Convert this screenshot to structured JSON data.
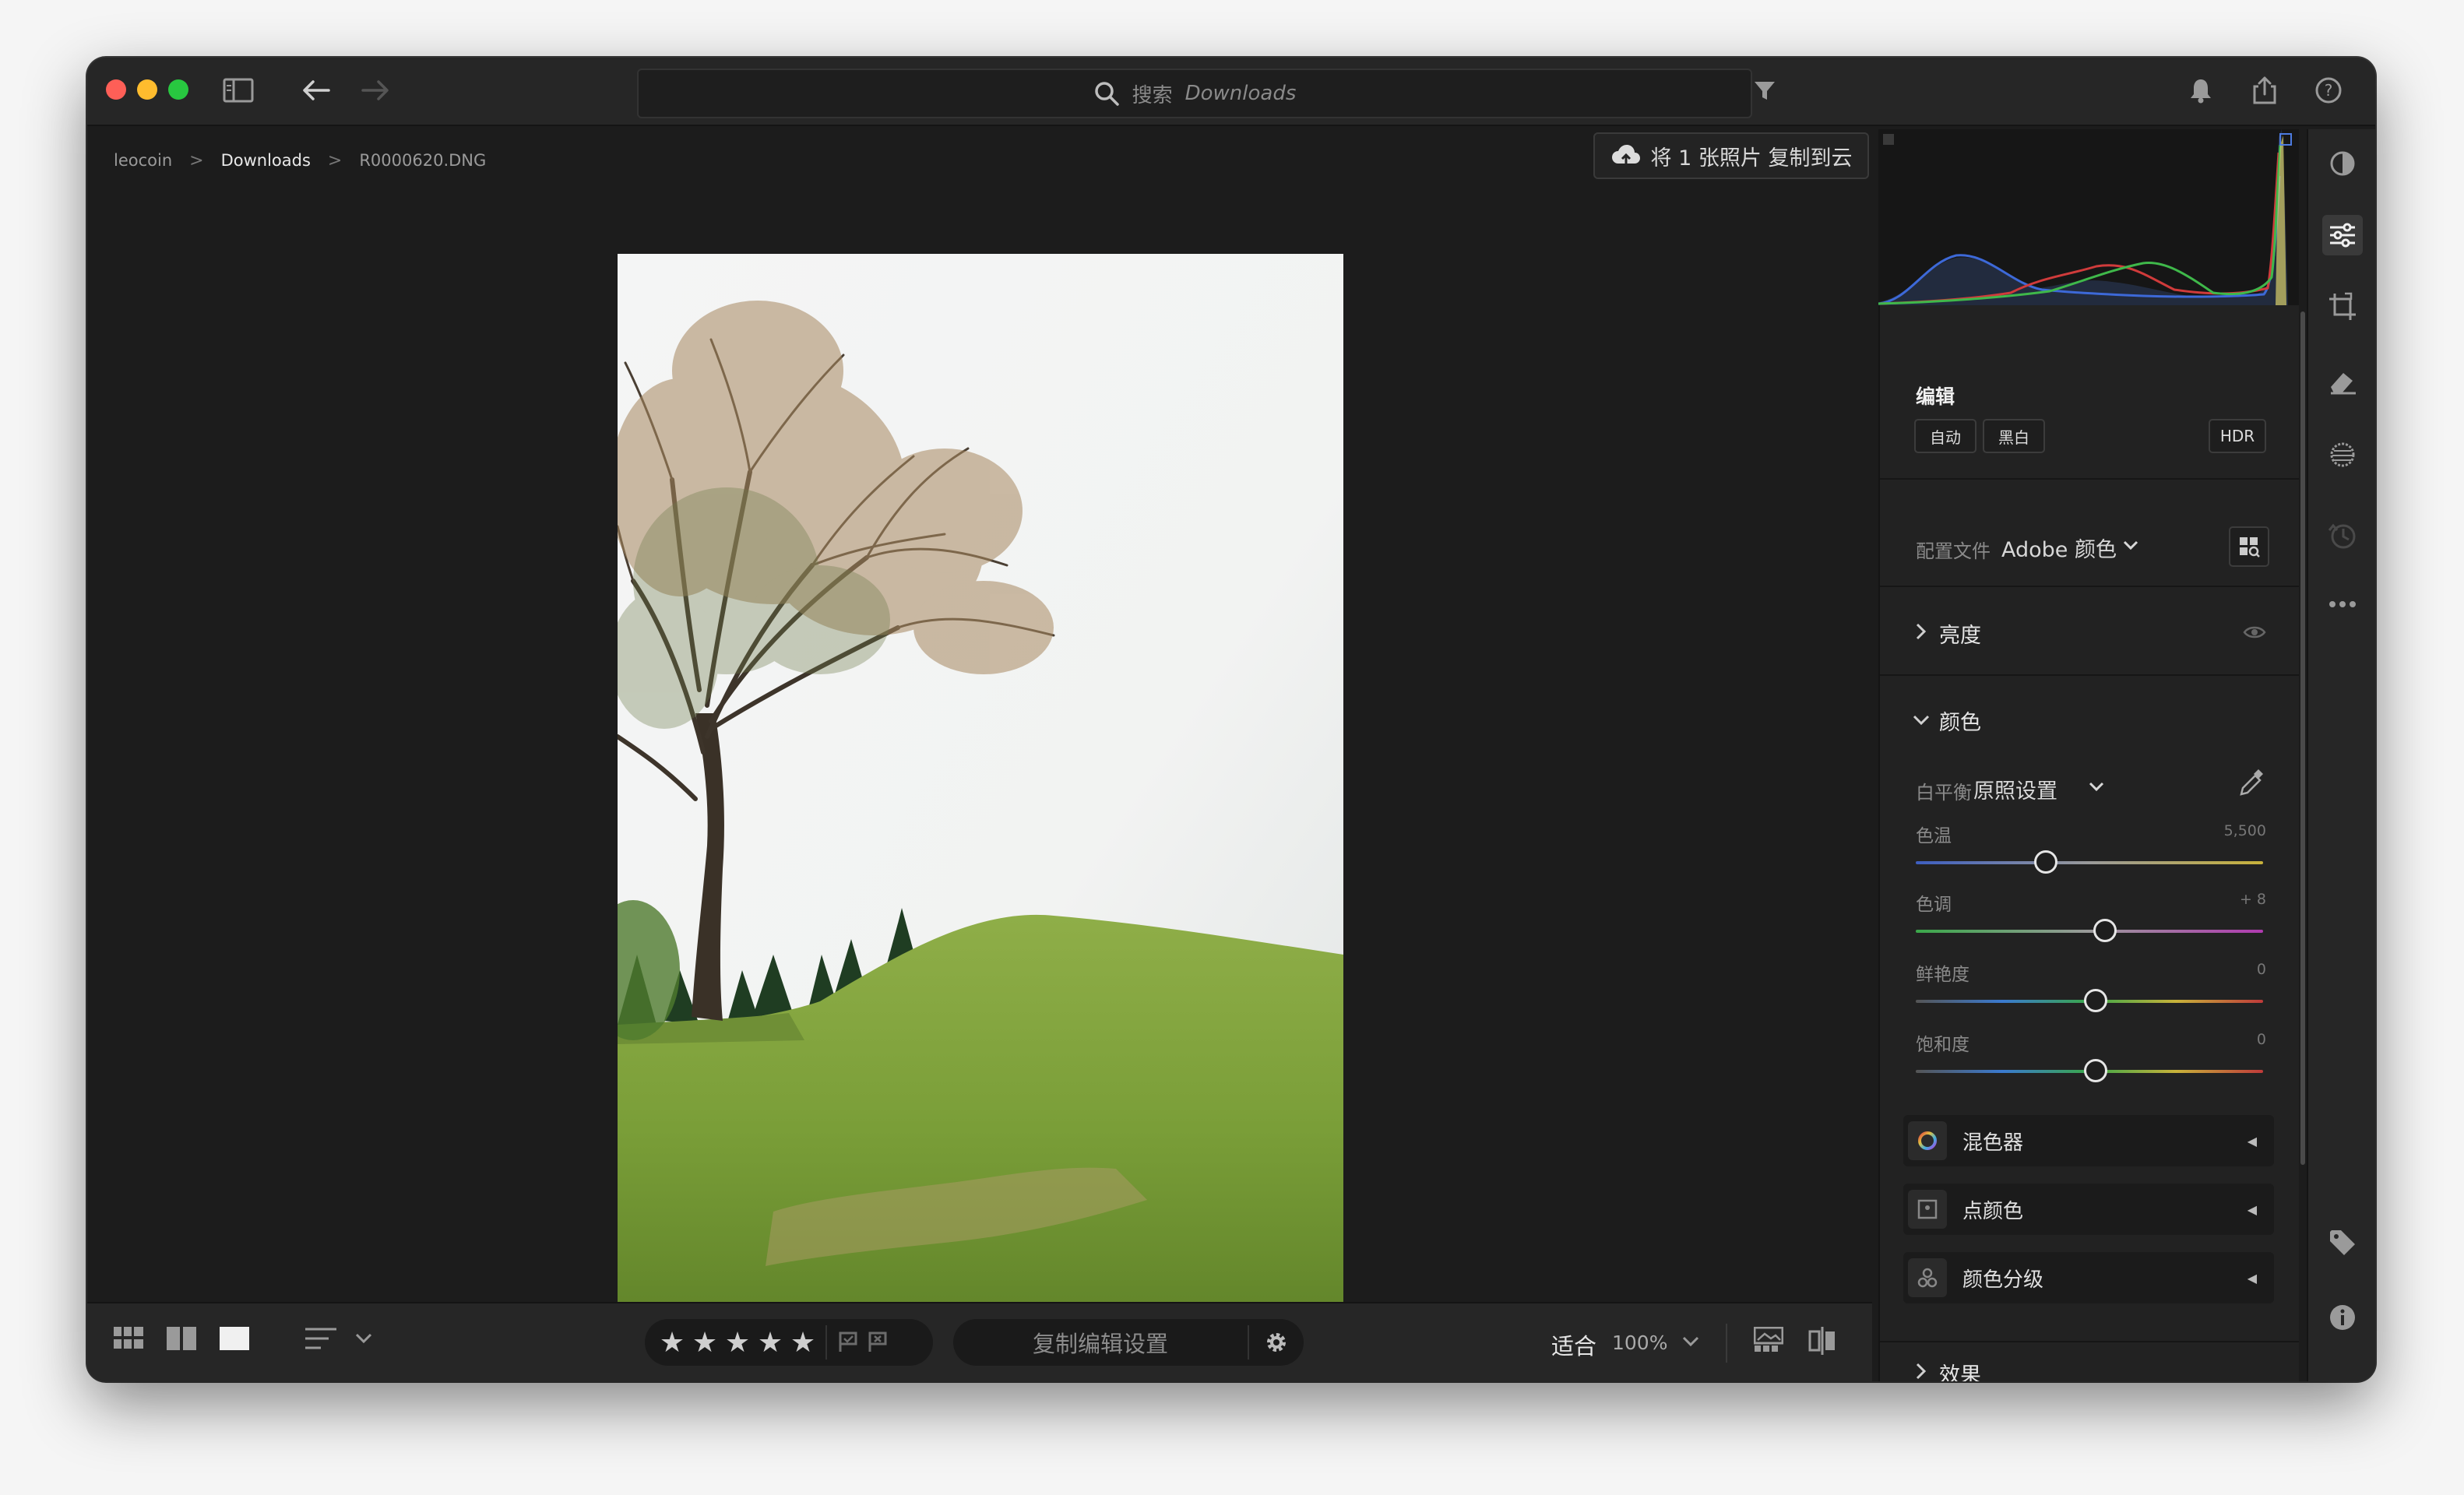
{
  "window": {
    "search_placeholder_prefix": "搜索",
    "search_placeholder_location": "Downloads"
  },
  "breadcrumb": {
    "items": [
      "leocoin",
      "Downloads",
      "R0000620.DNG"
    ],
    "separator": ">"
  },
  "cloud_copy": {
    "label": "将 1 张照片 复制到云"
  },
  "bottombar": {
    "stars": [
      "★",
      "★",
      "★",
      "★",
      "★"
    ],
    "copy_settings_label": "复制编辑设置",
    "zoom_fit_label": "适合",
    "zoom_percent": "100%"
  },
  "edit_panel": {
    "title": "编辑",
    "buttons": {
      "auto": "自动",
      "bw": "黑白",
      "hdr": "HDR"
    },
    "profile": {
      "label": "配置文件",
      "value": "Adobe 颜色"
    },
    "sections": {
      "light": "亮度",
      "color": "颜色",
      "effects": "效果"
    },
    "white_balance": {
      "label": "白平衡",
      "value": "原照设置"
    },
    "sliders": [
      {
        "label": "色温",
        "value": "5,500",
        "position": 0.37
      },
      {
        "label": "色调",
        "value": "+ 8",
        "position": 0.54
      },
      {
        "label": "鲜艳度",
        "value": "0",
        "position": 0.51
      },
      {
        "label": "饱和度",
        "value": "0",
        "position": 0.51
      }
    ],
    "sub_panels": [
      "混色器",
      "点颜色",
      "颜色分级"
    ]
  },
  "icons": {
    "left": [
      "sidebar-toggle-icon",
      "back-arrow-icon",
      "forward-arrow-icon"
    ],
    "right": [
      "filter-icon",
      "bell-icon",
      "share-icon",
      "help-icon",
      "cloud-icon"
    ],
    "tools": [
      "presets-icon",
      "edit-sliders-icon",
      "crop-icon",
      "healing-eraser-icon",
      "masking-icon",
      "versions-icon",
      "more-icon",
      "keywords-tag-icon",
      "info-icon"
    ]
  },
  "colors": {
    "window_bg": "#1c1c1c",
    "panel_bg": "#222222",
    "accent_close": "#fe5f57",
    "accent_min": "#febc2e",
    "accent_max": "#28c840"
  }
}
